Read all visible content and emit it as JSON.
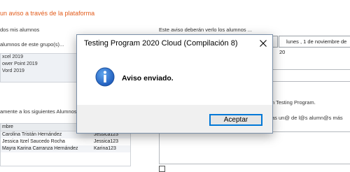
{
  "background": {
    "title": "un aviso a través de la plataforma",
    "label_students": "dos mis alumnos",
    "label_groups": "alumnos de este grupo(s)...",
    "groups": [
      "xcel 2019",
      "ower Point 2019",
      "Vord 2019"
    ],
    "label_specific": "amente a los siguientes Alumnos...",
    "table_header": "mbre",
    "students": [
      {
        "name": "Carolina Tristán Hernández",
        "user": "Jessica123"
      },
      {
        "name": "Jessica Itzel Saucedo Rocha",
        "user": "Jessica123"
      },
      {
        "name": "Mayra Karina Carranza Hernández",
        "user": "Karina123"
      }
    ],
    "right_label": "Este aviso deberán verlo los alumnos ...",
    "date_value": "lunes    , 1 de noviembre de 20",
    "testing_text": "n Testing Program.",
    "visible_text": "as un@ de l@s alumn@s más"
  },
  "dialog": {
    "title": "Testing Program 2020 Cloud (Compilación 8)",
    "message": "Aviso enviado.",
    "ok_label": "Aceptar",
    "icon": "info-icon",
    "close_icon": "close-icon"
  }
}
